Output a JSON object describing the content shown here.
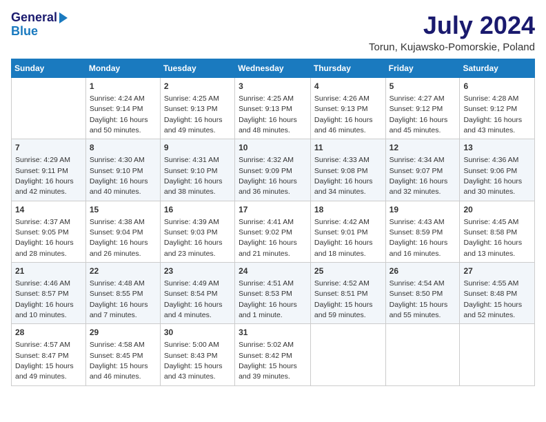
{
  "header": {
    "logo_line1": "General",
    "logo_line2": "Blue",
    "title": "July 2024",
    "subtitle": "Torun, Kujawsko-Pomorskie, Poland"
  },
  "days_of_week": [
    "Sunday",
    "Monday",
    "Tuesday",
    "Wednesday",
    "Thursday",
    "Friday",
    "Saturday"
  ],
  "weeks": [
    [
      {
        "day": "",
        "info": ""
      },
      {
        "day": "1",
        "info": "Sunrise: 4:24 AM\nSunset: 9:14 PM\nDaylight: 16 hours\nand 50 minutes."
      },
      {
        "day": "2",
        "info": "Sunrise: 4:25 AM\nSunset: 9:13 PM\nDaylight: 16 hours\nand 49 minutes."
      },
      {
        "day": "3",
        "info": "Sunrise: 4:25 AM\nSunset: 9:13 PM\nDaylight: 16 hours\nand 48 minutes."
      },
      {
        "day": "4",
        "info": "Sunrise: 4:26 AM\nSunset: 9:13 PM\nDaylight: 16 hours\nand 46 minutes."
      },
      {
        "day": "5",
        "info": "Sunrise: 4:27 AM\nSunset: 9:12 PM\nDaylight: 16 hours\nand 45 minutes."
      },
      {
        "day": "6",
        "info": "Sunrise: 4:28 AM\nSunset: 9:12 PM\nDaylight: 16 hours\nand 43 minutes."
      }
    ],
    [
      {
        "day": "7",
        "info": "Sunrise: 4:29 AM\nSunset: 9:11 PM\nDaylight: 16 hours\nand 42 minutes."
      },
      {
        "day": "8",
        "info": "Sunrise: 4:30 AM\nSunset: 9:10 PM\nDaylight: 16 hours\nand 40 minutes."
      },
      {
        "day": "9",
        "info": "Sunrise: 4:31 AM\nSunset: 9:10 PM\nDaylight: 16 hours\nand 38 minutes."
      },
      {
        "day": "10",
        "info": "Sunrise: 4:32 AM\nSunset: 9:09 PM\nDaylight: 16 hours\nand 36 minutes."
      },
      {
        "day": "11",
        "info": "Sunrise: 4:33 AM\nSunset: 9:08 PM\nDaylight: 16 hours\nand 34 minutes."
      },
      {
        "day": "12",
        "info": "Sunrise: 4:34 AM\nSunset: 9:07 PM\nDaylight: 16 hours\nand 32 minutes."
      },
      {
        "day": "13",
        "info": "Sunrise: 4:36 AM\nSunset: 9:06 PM\nDaylight: 16 hours\nand 30 minutes."
      }
    ],
    [
      {
        "day": "14",
        "info": "Sunrise: 4:37 AM\nSunset: 9:05 PM\nDaylight: 16 hours\nand 28 minutes."
      },
      {
        "day": "15",
        "info": "Sunrise: 4:38 AM\nSunset: 9:04 PM\nDaylight: 16 hours\nand 26 minutes."
      },
      {
        "day": "16",
        "info": "Sunrise: 4:39 AM\nSunset: 9:03 PM\nDaylight: 16 hours\nand 23 minutes."
      },
      {
        "day": "17",
        "info": "Sunrise: 4:41 AM\nSunset: 9:02 PM\nDaylight: 16 hours\nand 21 minutes."
      },
      {
        "day": "18",
        "info": "Sunrise: 4:42 AM\nSunset: 9:01 PM\nDaylight: 16 hours\nand 18 minutes."
      },
      {
        "day": "19",
        "info": "Sunrise: 4:43 AM\nSunset: 8:59 PM\nDaylight: 16 hours\nand 16 minutes."
      },
      {
        "day": "20",
        "info": "Sunrise: 4:45 AM\nSunset: 8:58 PM\nDaylight: 16 hours\nand 13 minutes."
      }
    ],
    [
      {
        "day": "21",
        "info": "Sunrise: 4:46 AM\nSunset: 8:57 PM\nDaylight: 16 hours\nand 10 minutes."
      },
      {
        "day": "22",
        "info": "Sunrise: 4:48 AM\nSunset: 8:55 PM\nDaylight: 16 hours\nand 7 minutes."
      },
      {
        "day": "23",
        "info": "Sunrise: 4:49 AM\nSunset: 8:54 PM\nDaylight: 16 hours\nand 4 minutes."
      },
      {
        "day": "24",
        "info": "Sunrise: 4:51 AM\nSunset: 8:53 PM\nDaylight: 16 hours\nand 1 minute."
      },
      {
        "day": "25",
        "info": "Sunrise: 4:52 AM\nSunset: 8:51 PM\nDaylight: 15 hours\nand 59 minutes."
      },
      {
        "day": "26",
        "info": "Sunrise: 4:54 AM\nSunset: 8:50 PM\nDaylight: 15 hours\nand 55 minutes."
      },
      {
        "day": "27",
        "info": "Sunrise: 4:55 AM\nSunset: 8:48 PM\nDaylight: 15 hours\nand 52 minutes."
      }
    ],
    [
      {
        "day": "28",
        "info": "Sunrise: 4:57 AM\nSunset: 8:47 PM\nDaylight: 15 hours\nand 49 minutes."
      },
      {
        "day": "29",
        "info": "Sunrise: 4:58 AM\nSunset: 8:45 PM\nDaylight: 15 hours\nand 46 minutes."
      },
      {
        "day": "30",
        "info": "Sunrise: 5:00 AM\nSunset: 8:43 PM\nDaylight: 15 hours\nand 43 minutes."
      },
      {
        "day": "31",
        "info": "Sunrise: 5:02 AM\nSunset: 8:42 PM\nDaylight: 15 hours\nand 39 minutes."
      },
      {
        "day": "",
        "info": ""
      },
      {
        "day": "",
        "info": ""
      },
      {
        "day": "",
        "info": ""
      }
    ]
  ]
}
